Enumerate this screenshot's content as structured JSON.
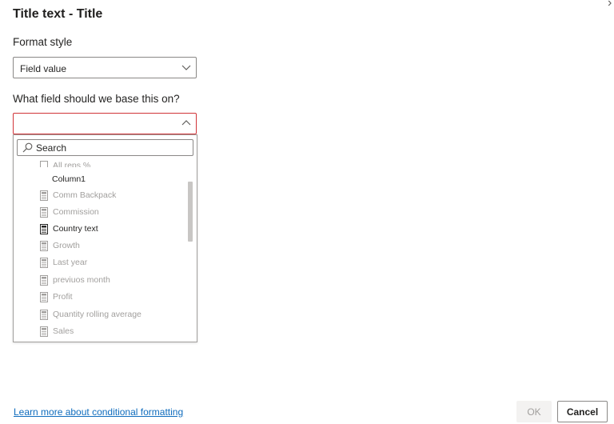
{
  "dialog": {
    "title": "Title text - Title",
    "format_style_label": "Format style",
    "format_style_value": "Field value",
    "field_question": "What field should we base this on?",
    "field_value": ""
  },
  "dropdown": {
    "search_placeholder": "Search",
    "items": [
      {
        "label": "All reps %",
        "icon": "calculator-icon",
        "enabled": false
      },
      {
        "label": "Column1",
        "icon": "",
        "enabled": true
      },
      {
        "label": "Comm Backpack",
        "icon": "calculator-icon",
        "enabled": false
      },
      {
        "label": "Commission",
        "icon": "calculator-icon",
        "enabled": false
      },
      {
        "label": "Country text",
        "icon": "calculator-icon",
        "enabled": true
      },
      {
        "label": "Growth",
        "icon": "calculator-icon",
        "enabled": false
      },
      {
        "label": "Last year",
        "icon": "calculator-icon",
        "enabled": false
      },
      {
        "label": "previuos month",
        "icon": "calculator-icon",
        "enabled": false
      },
      {
        "label": "Profit",
        "icon": "calculator-icon",
        "enabled": false
      },
      {
        "label": "Quantity rolling average",
        "icon": "calculator-icon",
        "enabled": false
      },
      {
        "label": "Sales",
        "icon": "calculator-icon",
        "enabled": false
      }
    ]
  },
  "footer": {
    "learn_link": "Learn more about conditional formatting",
    "ok_label": "OK",
    "cancel_label": "Cancel"
  },
  "colors": {
    "link": "#0f6cbd",
    "error_border": "#d13438",
    "disabled_text": "#a19f9d"
  }
}
